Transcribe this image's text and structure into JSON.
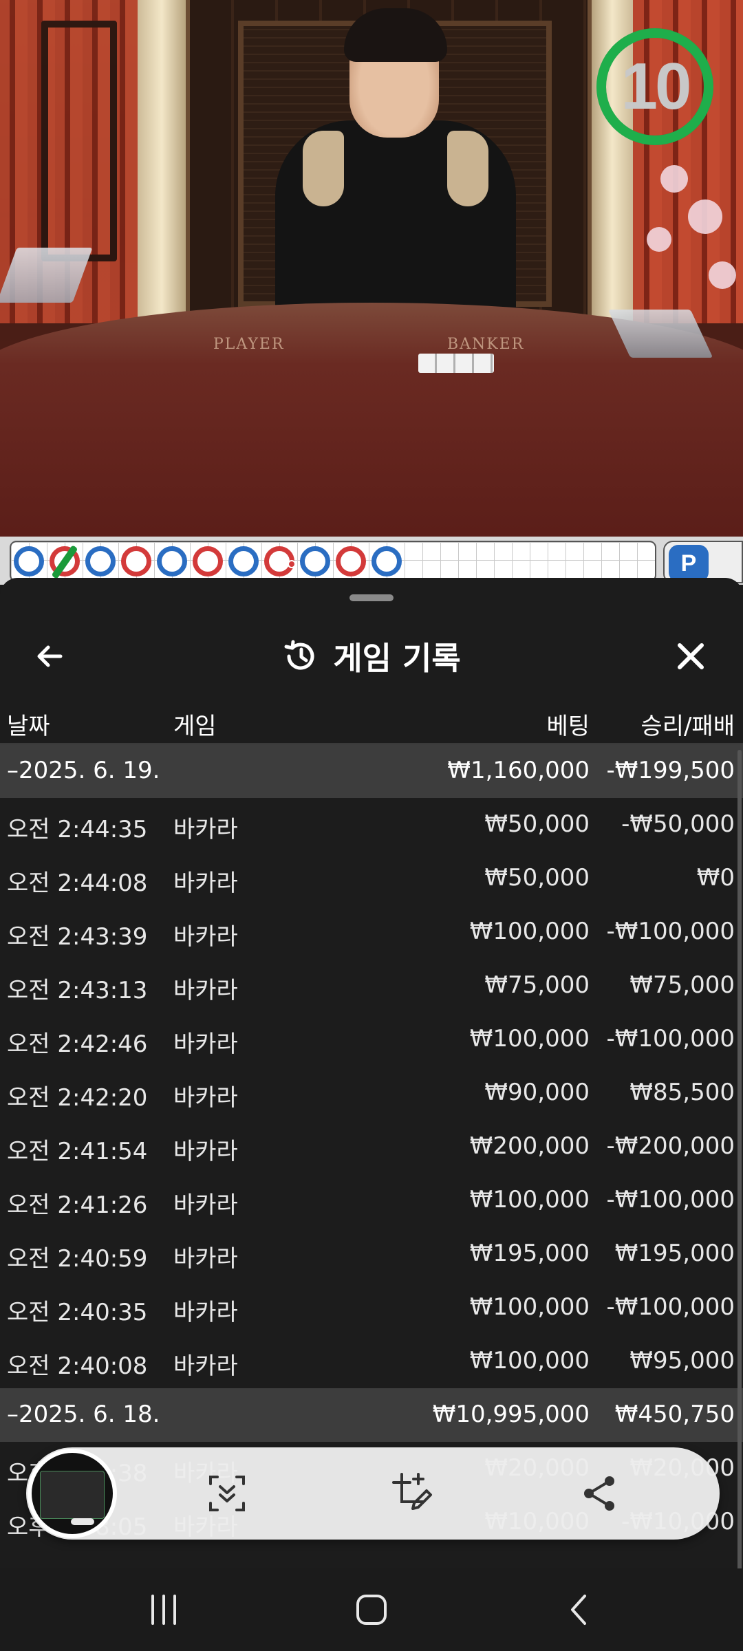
{
  "timer": {
    "value": "10",
    "color": "#1fae4b"
  },
  "road": {
    "beads": [
      "player",
      "banker",
      "player",
      "banker",
      "player",
      "banker",
      "player",
      "banker",
      "player",
      "banker",
      "player"
    ],
    "badge": "P"
  },
  "history": {
    "title": "게임 기록",
    "columns": {
      "date": "날짜",
      "game": "게임",
      "bet": "베팅",
      "result": "승리/패배"
    },
    "groups": [
      {
        "date": "–2025. 6. 19.",
        "total_bet": "₩1,160,000",
        "total_result": "-₩199,500",
        "rows": [
          {
            "time": "오전 2:44:35",
            "game": "바카라",
            "bet": "₩50,000",
            "result": "-₩50,000"
          },
          {
            "time": "오전 2:44:08",
            "game": "바카라",
            "bet": "₩50,000",
            "result": "₩0"
          },
          {
            "time": "오전 2:43:39",
            "game": "바카라",
            "bet": "₩100,000",
            "result": "-₩100,000"
          },
          {
            "time": "오전 2:43:13",
            "game": "바카라",
            "bet": "₩75,000",
            "result": "₩75,000"
          },
          {
            "time": "오전 2:42:46",
            "game": "바카라",
            "bet": "₩100,000",
            "result": "-₩100,000"
          },
          {
            "time": "오전 2:42:20",
            "game": "바카라",
            "bet": "₩90,000",
            "result": "₩85,500"
          },
          {
            "time": "오전 2:41:54",
            "game": "바카라",
            "bet": "₩200,000",
            "result": "-₩200,000"
          },
          {
            "time": "오전 2:41:26",
            "game": "바카라",
            "bet": "₩100,000",
            "result": "-₩100,000"
          },
          {
            "time": "오전 2:40:59",
            "game": "바카라",
            "bet": "₩195,000",
            "result": "₩195,000"
          },
          {
            "time": "오전 2:40:35",
            "game": "바카라",
            "bet": "₩100,000",
            "result": "-₩100,000"
          },
          {
            "time": "오전 2:40:08",
            "game": "바카라",
            "bet": "₩100,000",
            "result": "₩95,000"
          }
        ]
      },
      {
        "date": "–2025. 6. 18.",
        "total_bet": "₩10,995,000",
        "total_result": "₩450,750",
        "rows": [
          {
            "time": "오후 8:38:38",
            "game": "바카라",
            "bet": "₩20,000",
            "result": "₩20,000"
          },
          {
            "time": "오후 8:38:05",
            "game": "바카라",
            "bet": "₩10,000",
            "result": "-₩10,000"
          }
        ]
      }
    ]
  },
  "icons": {
    "back": "arrow-left-icon",
    "history": "history-icon",
    "close": "close-icon",
    "scroll_capture": "scroll-capture-icon",
    "crop_edit": "crop-edit-icon",
    "share": "share-icon",
    "nav_recents": "recents-icon",
    "nav_home": "home-icon",
    "nav_back": "nav-back-icon"
  }
}
